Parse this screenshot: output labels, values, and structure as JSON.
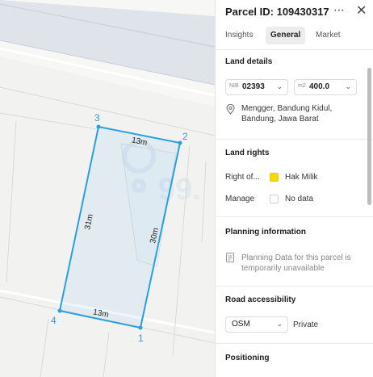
{
  "map": {
    "vertex_labels": [
      "1",
      "2",
      "3",
      "4"
    ],
    "edge_labels": [
      "13m",
      "30m",
      "31m",
      "13m"
    ],
    "watermark": "99.",
    "colors": {
      "parcel_stroke": "#2a9fe0",
      "parcel_fill": "rgba(42,159,224,0.08)",
      "road": "#dfe3ea"
    }
  },
  "panel": {
    "title": "Parcel ID: 109430317",
    "more_icon": "⋯",
    "close_icon": "✕",
    "tabs": [
      {
        "label": "Insights",
        "active": false
      },
      {
        "label": "General",
        "active": true
      },
      {
        "label": "Market",
        "active": false
      }
    ],
    "land_details": {
      "title": "Land details",
      "nib": {
        "prefix": "NIB",
        "value": "02393"
      },
      "area": {
        "prefix": "m2",
        "value": "400.0"
      },
      "address": "Mengger, Bandung Kidul, Bandung, Jawa Barat"
    },
    "land_rights": {
      "title": "Land rights",
      "rows": [
        {
          "label": "Right of...",
          "value": "Hak Milik",
          "color": "#f5d90a"
        },
        {
          "label": "Manage",
          "value": "No data",
          "color": "#ffffff"
        }
      ]
    },
    "planning": {
      "title": "Planning information",
      "message": "Planning Data for this parcel is temporarily unavailable"
    },
    "road": {
      "title": "Road accessibility",
      "select": "OSM",
      "value": "Private"
    },
    "positioning": {
      "title": "Positioning"
    }
  }
}
